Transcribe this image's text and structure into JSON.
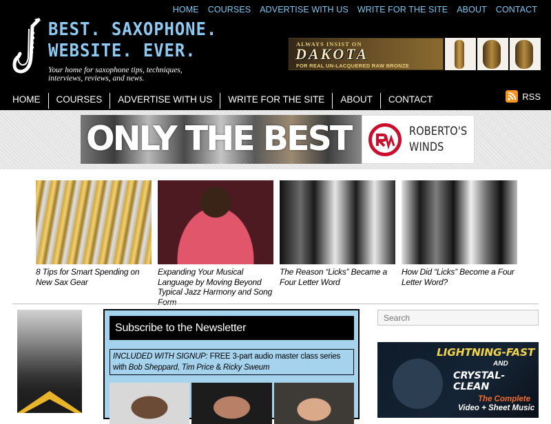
{
  "site": {
    "title_line1": "BEST. SAXOPHONE.",
    "title_line2": "WEBSITE. EVER.",
    "tagline": "Your home for saxophone tips, techniques, interviews, reviews, and news."
  },
  "top_nav": [
    "HOME",
    "COURSES",
    "ADVERTISE WITH US",
    "WRITE FOR THE SITE",
    "ABOUT",
    "CONTACT"
  ],
  "main_nav": [
    "HOME",
    "COURSES",
    "ADVERTISE WITH US",
    "WRITE FOR THE SITE",
    "ABOUT",
    "CONTACT"
  ],
  "rss_label": "RSS",
  "header_ad": {
    "top_line": "ALWAYS INSIST ON",
    "brand": "DAKOTA",
    "bottom_line": "FOR REAL UN-LACQUERED RAW BRONZE"
  },
  "banner": {
    "headline": "ONLY THE BEST",
    "sponsor_line1": "ROBERTO'S",
    "sponsor_line2": "WINDS"
  },
  "articles": [
    {
      "title": "8 Tips for Smart Spending on New Sax Gear"
    },
    {
      "title": "Expanding Your Musical Language by Moving Beyond Typical Jazz Harmony and Song Form"
    },
    {
      "title": "The Reason “Licks” Became a Four Letter Word"
    },
    {
      "title": "How Did “Licks” Become a Four Letter Word?"
    }
  ],
  "newsletter": {
    "heading": "Subscribe to the Newsletter",
    "included_label": "INCLUDED WITH SIGNUP:",
    "offer_text": " FREE 3-part audio master class series with ",
    "names_1": "Bob Sheppard",
    "sep1": ", ",
    "names_2": "Tim Price",
    "sep2": " & ",
    "names_3": "Ricky Sweum"
  },
  "search": {
    "placeholder": "Search"
  },
  "sidebar_ad": {
    "line1": "LIGHTNING-FAST",
    "line2": "AND",
    "line3": "CRYSTAL-CLEAN",
    "line4": "The Complete",
    "line5": "Video + Sheet Music"
  },
  "colors": {
    "link_blue": "#7ec8f0",
    "header_bg": "#000000",
    "newsletter_bg": "#a5d3ee",
    "rss_orange": "#f7931e"
  }
}
